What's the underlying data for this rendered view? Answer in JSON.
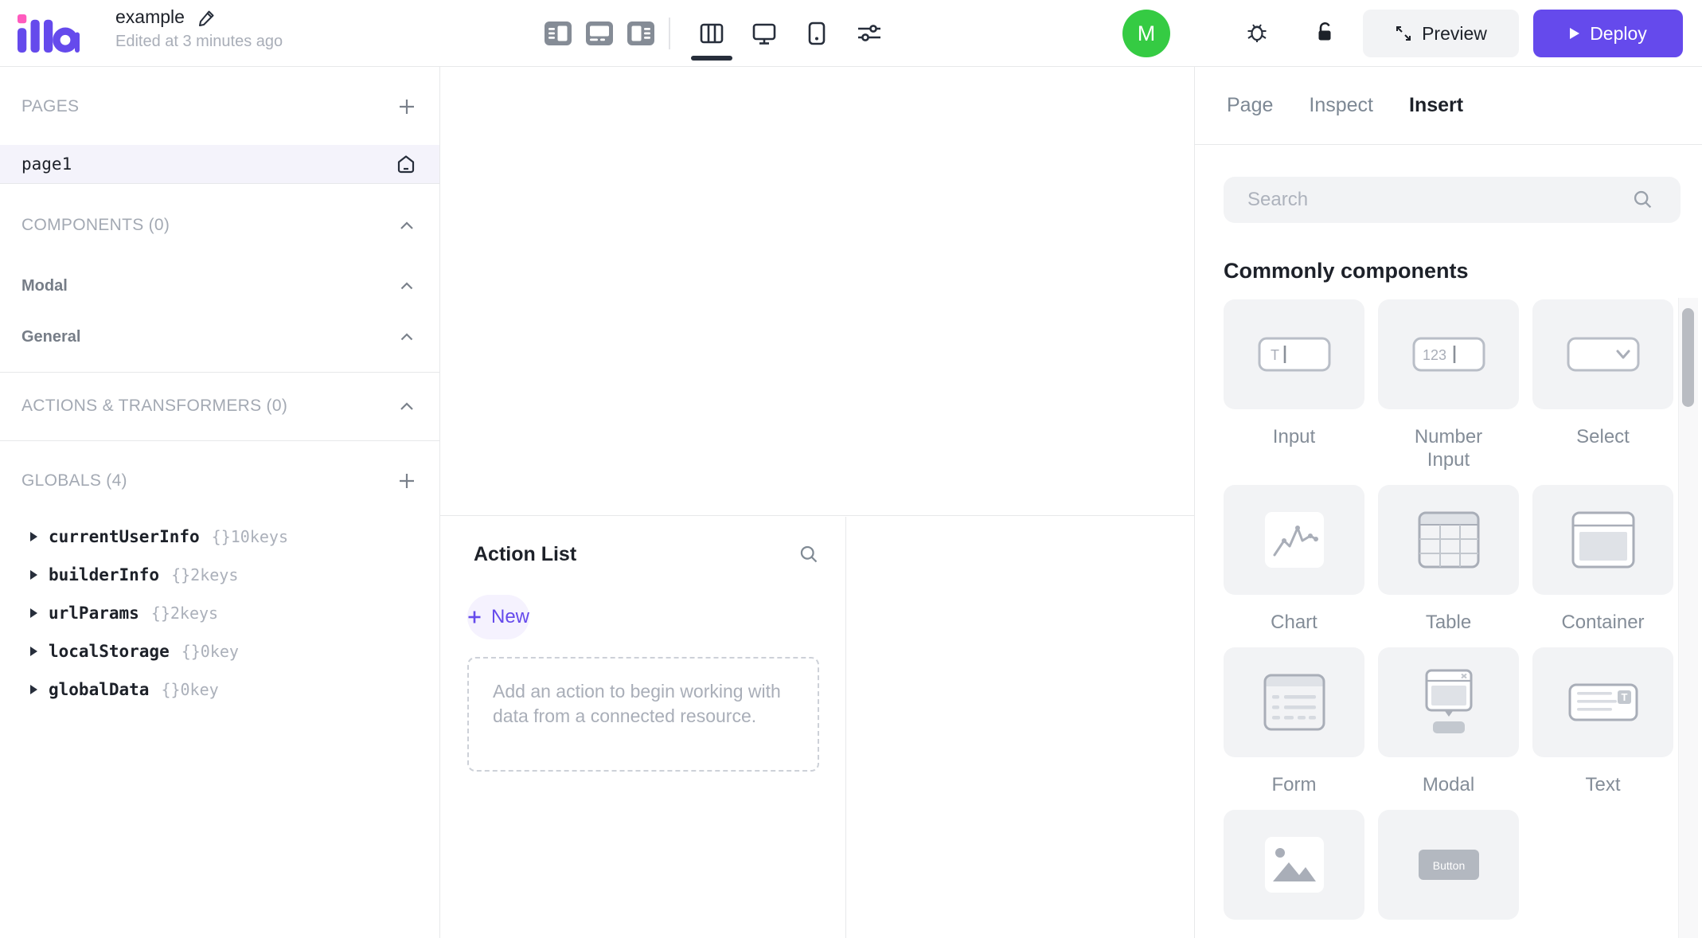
{
  "topbar": {
    "app_name": "illa",
    "project_title": "example",
    "edited_status": "Edited at 3 minutes ago",
    "avatar_initial": "M",
    "preview_label": "Preview",
    "deploy_label": "Deploy"
  },
  "left_sidebar": {
    "pages_header": "PAGES",
    "pages": [
      {
        "name": "page1"
      }
    ],
    "components_header": "COMPONENTS (0)",
    "component_groups": [
      {
        "label": "Modal"
      },
      {
        "label": "General"
      }
    ],
    "actions_header": "ACTIONS & TRANSFORMERS (0)",
    "globals_header": "GLOBALS (4)",
    "globals": [
      {
        "name": "currentUserInfo",
        "meta": "{}10keys"
      },
      {
        "name": "builderInfo",
        "meta": "{}2keys"
      },
      {
        "name": "urlParams",
        "meta": "{}2keys"
      },
      {
        "name": "localStorage",
        "meta": "{}0key"
      },
      {
        "name": "globalData",
        "meta": "{}0key"
      }
    ]
  },
  "action_panel": {
    "title": "Action List",
    "new_button_label": "New",
    "empty_hint": "Add an action to begin working with data from a connected resource."
  },
  "right_panel": {
    "tabs": [
      {
        "label": "Page"
      },
      {
        "label": "Inspect"
      },
      {
        "label": "Insert"
      }
    ],
    "active_tab": "Insert",
    "search_placeholder": "Search",
    "section_title": "Commonly components",
    "components": [
      {
        "label": "Input",
        "glyph": "text-input",
        "glyph_text": "T"
      },
      {
        "label": "Number Input",
        "glyph": "number-input",
        "glyph_text": "123"
      },
      {
        "label": "Select",
        "glyph": "select"
      },
      {
        "label": "Chart",
        "glyph": "chart"
      },
      {
        "label": "Table",
        "glyph": "table"
      },
      {
        "label": "Container",
        "glyph": "container"
      },
      {
        "label": "Form",
        "glyph": "form"
      },
      {
        "label": "Modal",
        "glyph": "modal"
      },
      {
        "label": "Text",
        "glyph": "text",
        "glyph_text": "T"
      },
      {
        "label": "",
        "glyph": "image"
      },
      {
        "label": "",
        "glyph": "button",
        "glyph_text": "Button"
      }
    ]
  },
  "colors": {
    "accent_purple": "#654AEC",
    "logo_pink": "#FF5BBE",
    "avatar_green": "#35CB43",
    "text_dark": "#1D2129",
    "text_gray": "#A9AEB8",
    "border": "#E7E8EA",
    "card_bg": "#F2F3F5"
  }
}
